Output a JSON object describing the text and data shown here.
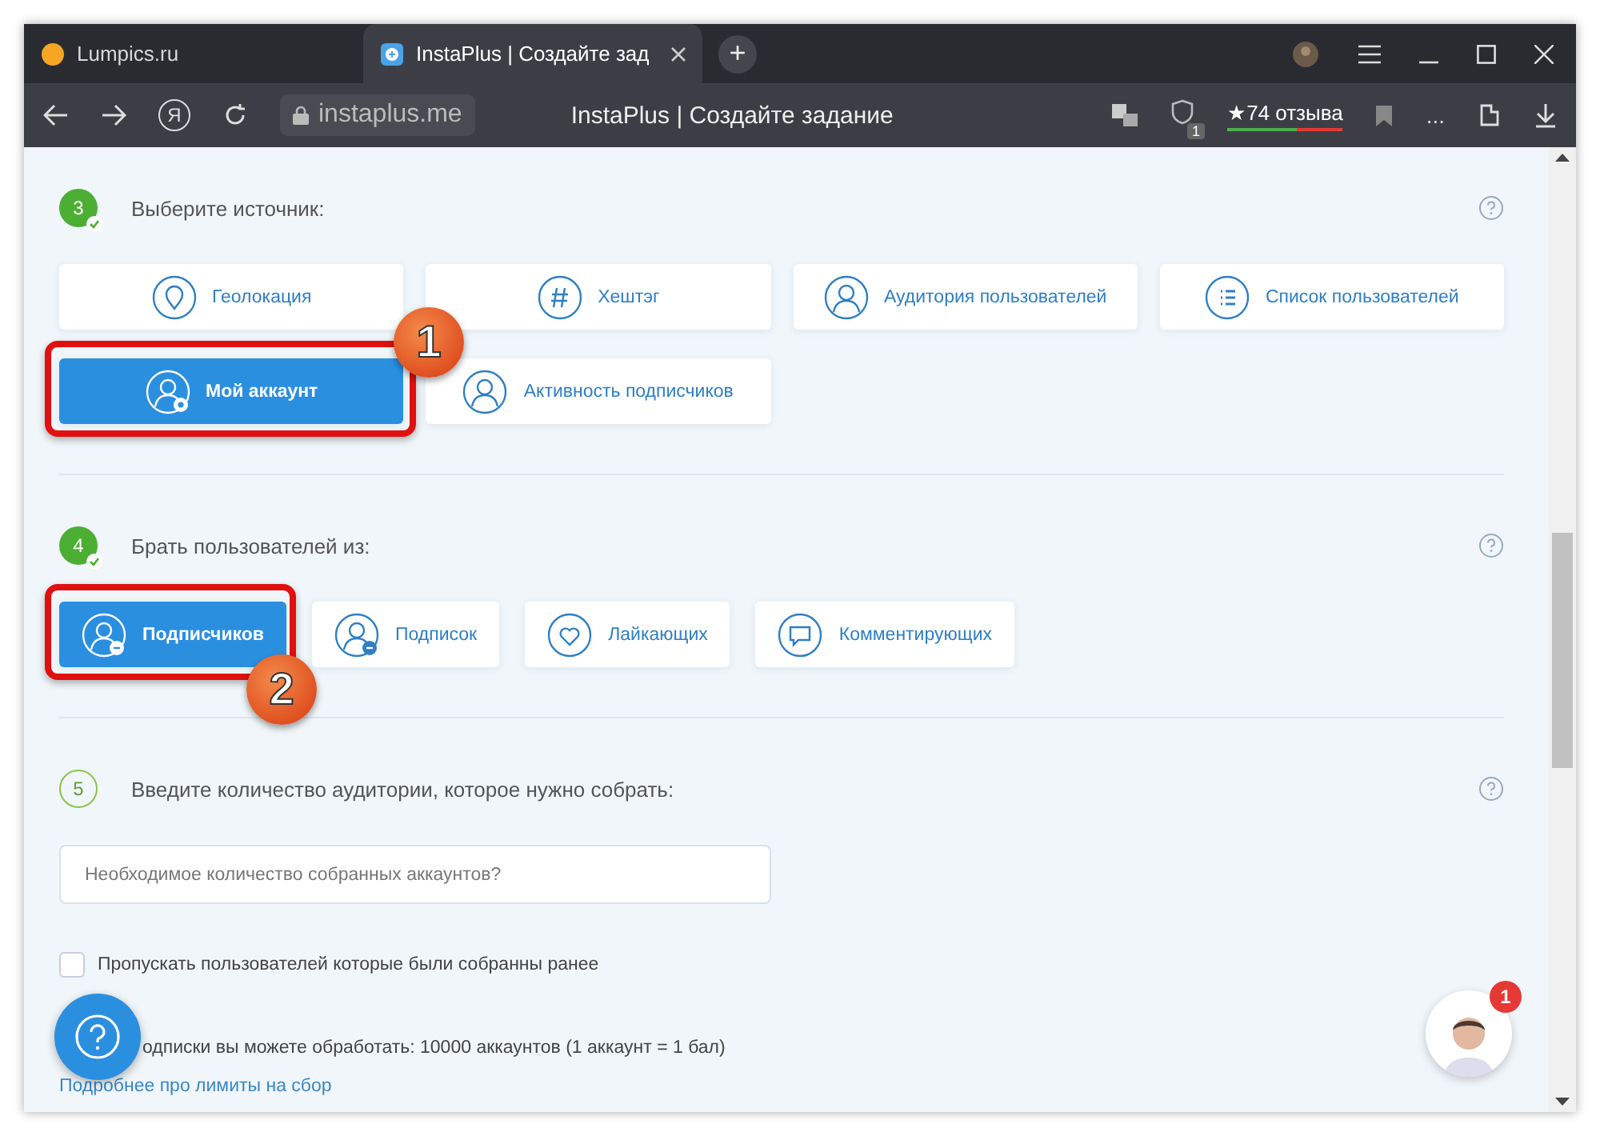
{
  "browser": {
    "tabs": [
      {
        "title": "Lumpics.ru",
        "selected": false
      },
      {
        "title": "InstaPlus | Создайте зад",
        "selected": true
      }
    ],
    "new_tab": "+",
    "yandex_button": "Я",
    "address": "instaplus.me",
    "page_title": "InstaPlus | Создайте задание",
    "shield_badge": "1",
    "reviews": "★74 отзыва",
    "more": "..."
  },
  "sections": [
    {
      "step": "3",
      "done": true,
      "title": "Выберите источник:",
      "kind": "grid",
      "options": [
        {
          "label": "Геолокация",
          "kind": "pin",
          "selected": false
        },
        {
          "label": "Хештэг",
          "kind": "hash",
          "selected": false
        },
        {
          "label": "Аудитория пользователей",
          "kind": "user",
          "selected": false
        },
        {
          "label": "Список пользователей",
          "kind": "list",
          "selected": false
        },
        {
          "label": "Мой аккаунт",
          "kind": "user-star",
          "selected": true
        },
        {
          "label": "Активность подписчиков",
          "kind": "user",
          "selected": false
        }
      ]
    },
    {
      "step": "4",
      "done": true,
      "title": "Брать пользователей из:",
      "kind": "row",
      "options": [
        {
          "label": "Подписчиков",
          "kind": "user-in",
          "selected": true
        },
        {
          "label": "Подписок",
          "kind": "user-out",
          "selected": false
        },
        {
          "label": "Лайкающих",
          "kind": "heart",
          "selected": false
        },
        {
          "label": "Комментирующих",
          "kind": "comment",
          "selected": false
        }
      ]
    },
    {
      "step": "5",
      "done": false,
      "kind": "field",
      "title": "Введите количество аудитории, которое нужно собрать:",
      "field": {
        "placeholder": "Необходимое количество собранных аккаунтов?"
      }
    }
  ],
  "checkbox": {
    "label": "Пропускать пользователей которые были собранны ранее",
    "checked": false
  },
  "limit_text": "одписки вы можете обработать: 10000 аккаунтов (1 аккаунт = 1 бал)",
  "link": "Подробнее про лимиты на сбор",
  "chat": {
    "badge": "1"
  },
  "annotations": [
    {
      "label": "1"
    },
    {
      "label": "2"
    }
  ]
}
